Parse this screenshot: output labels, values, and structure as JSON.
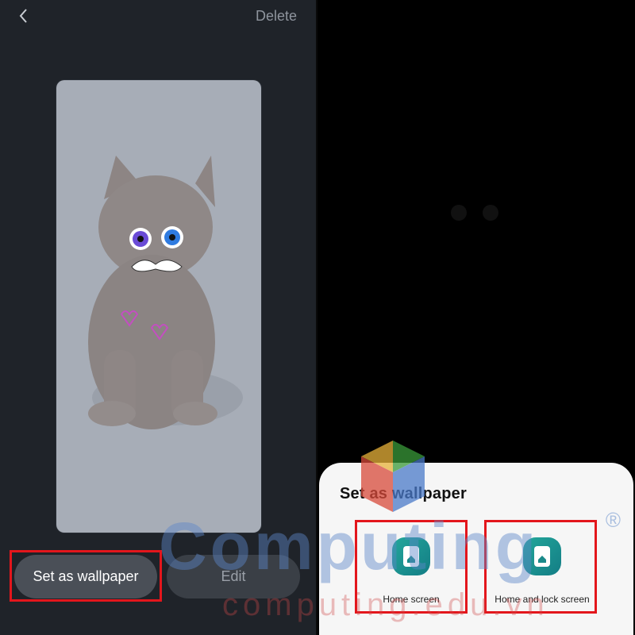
{
  "left": {
    "back_icon": "chevron-left-icon",
    "delete_label": "Delete",
    "set_button_label": "Set as wallpaper",
    "edit_button_label": "Edit"
  },
  "sheet": {
    "title": "Set as wallpaper",
    "options": [
      {
        "label": "Home screen",
        "icon": "home-screen-icon"
      },
      {
        "label": "Home and lock screen",
        "icon": "home-lock-screen-icon"
      }
    ]
  },
  "watermark": {
    "brand": "Computing",
    "site": "computing.edu.vn",
    "registered": "®"
  },
  "colors": {
    "highlight": "#e3161c",
    "accent": "#23a79b"
  }
}
